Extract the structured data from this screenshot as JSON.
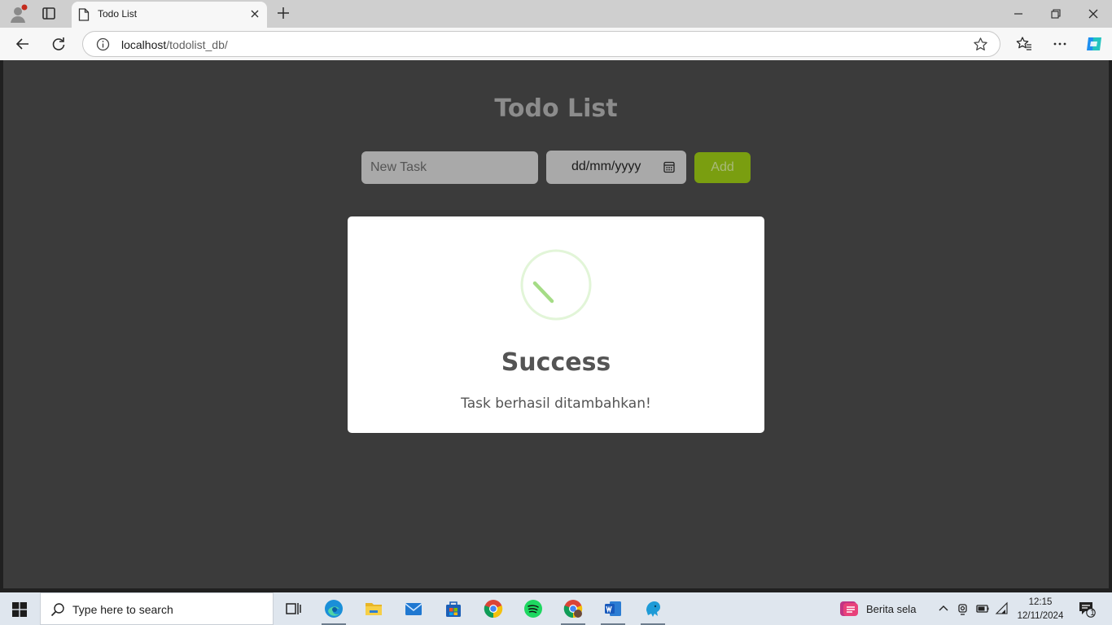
{
  "browser": {
    "tab_title": "Todo List",
    "url_host": "localhost",
    "url_path": "/todolist_db/"
  },
  "page": {
    "title": "Todo List",
    "task_input_placeholder": "New Task",
    "date_placeholder": "dd/mm/yyyy",
    "add_label": "Add"
  },
  "modal": {
    "title": "Success",
    "message": "Task berhasil ditambahkan!"
  },
  "taskbar": {
    "search_placeholder": "Type here to search",
    "news": "Berita sela",
    "time": "12:15",
    "date": "12/11/2024",
    "notification_count": "1"
  },
  "colors": {
    "page_bg": "#3b3b3b",
    "add_button": "#7a9e10",
    "success_green": "#a5dc86"
  }
}
